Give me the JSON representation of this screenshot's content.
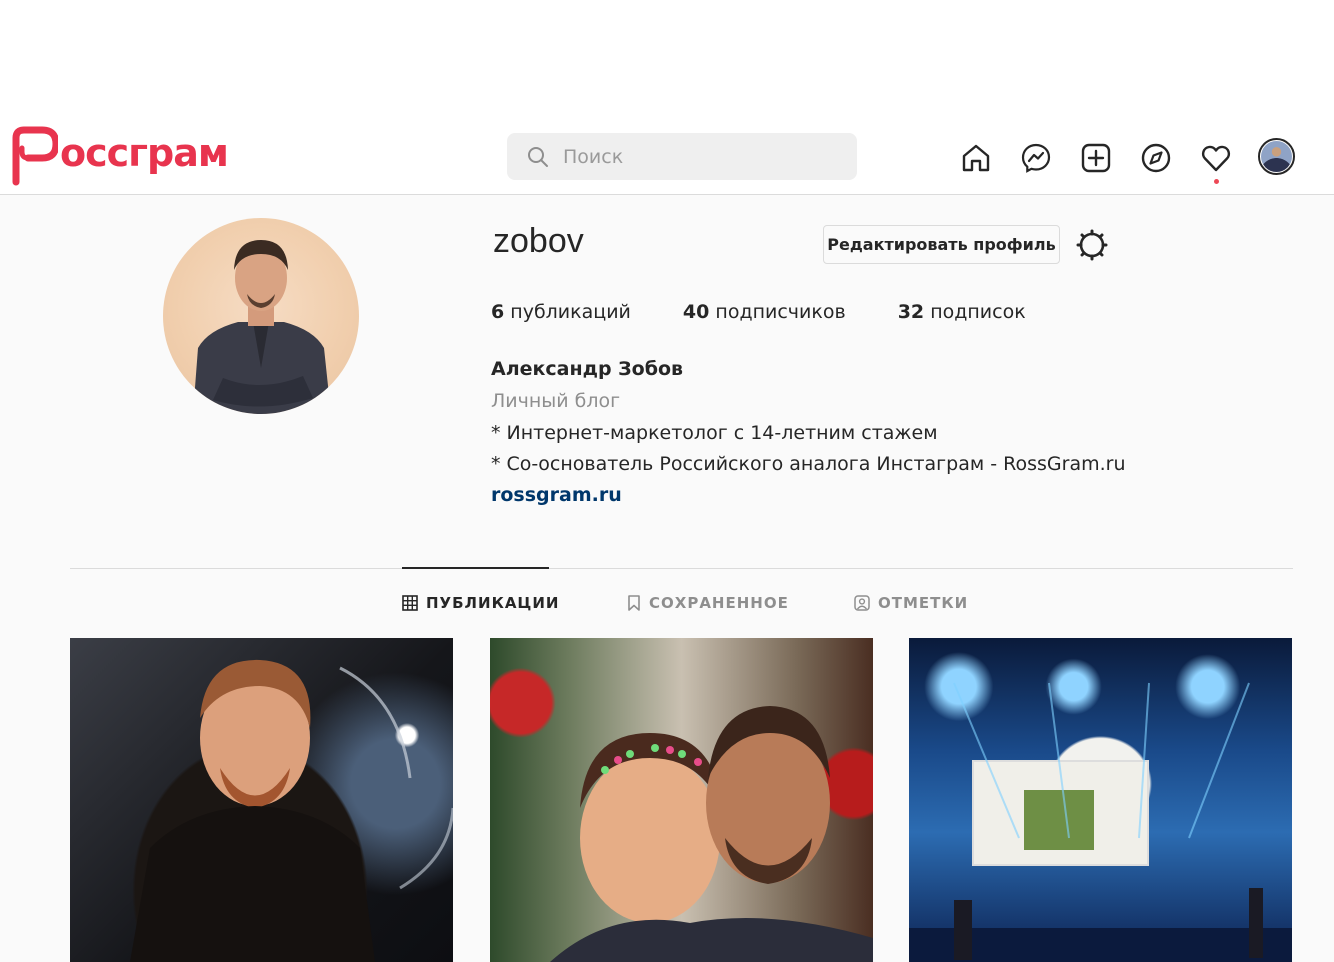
{
  "header": {
    "logo_text": "оссграм",
    "search_placeholder": "Поиск",
    "nav_icons": [
      "home-icon",
      "messenger-icon",
      "new-post-icon",
      "explore-icon",
      "activity-heart-icon",
      "profile-avatar"
    ]
  },
  "profile": {
    "username": "zobov",
    "edit_button": "Редактировать профиль",
    "stats": {
      "posts_count": "6",
      "posts_label": "публикаций",
      "followers_count": "40",
      "followers_label": "подписчиков",
      "following_count": "32",
      "following_label": "подписок"
    },
    "full_name": "Александр Зобов",
    "category": "Личный блог",
    "bio_line1": "* Интернет-маркетолог с 14-летним стажем",
    "bio_line2": "* Со-основатель Российского аналога Инстаграм - RossGram.ru",
    "website": "rossgram.ru"
  },
  "tabs": [
    {
      "label": "ПУБЛИКАЦИИ",
      "icon": "grid-icon",
      "active": true
    },
    {
      "label": "СОХРАНЕННОЕ",
      "icon": "bookmark-icon",
      "active": false
    },
    {
      "label": "ОТМЕТКИ",
      "icon": "tagged-icon",
      "active": false
    }
  ],
  "colors": {
    "brand": "#e8344e",
    "link": "#00376b",
    "notification_dot": "#ed4956"
  }
}
